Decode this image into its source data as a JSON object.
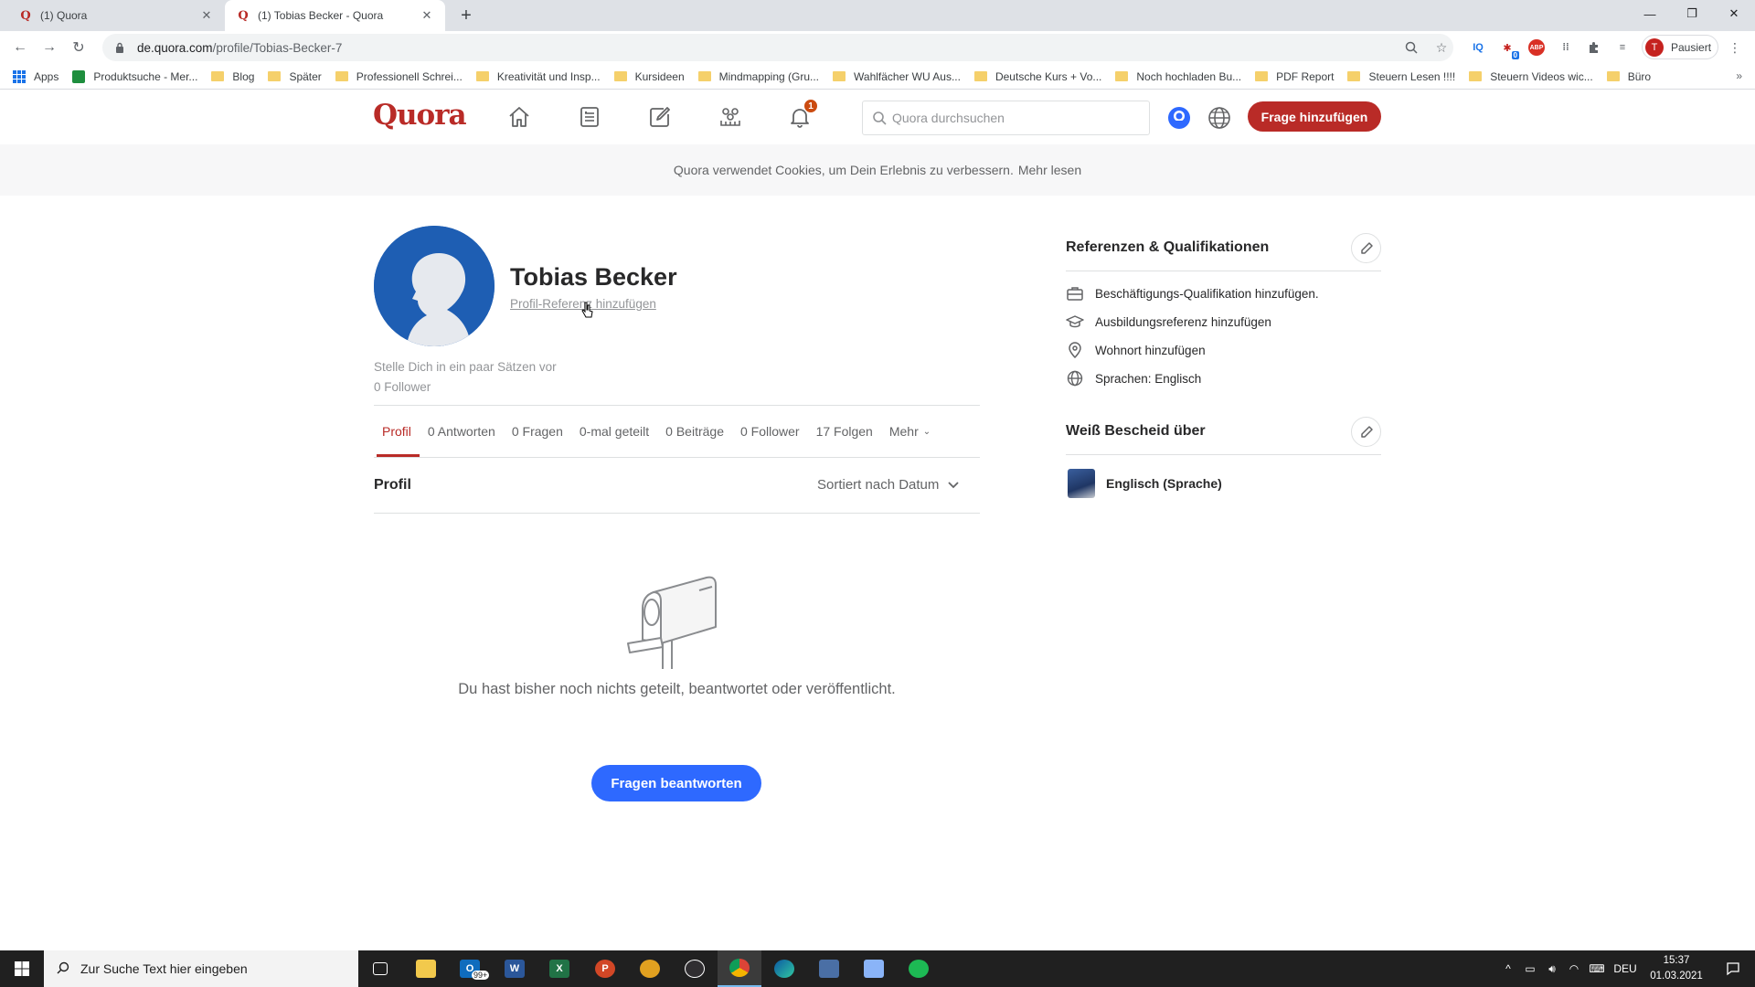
{
  "browser": {
    "tabs": [
      {
        "title": "(1) Quora"
      },
      {
        "title": "(1) Tobias Becker - Quora"
      }
    ],
    "url_host": "de.quora.com",
    "url_path": "/profile/Tobias-Becker-7",
    "profile_label": "Pausiert",
    "profile_initial": "T",
    "ext_badge": "0",
    "bookmarks": [
      {
        "label": "Apps",
        "icon": "apps-grid-icon"
      },
      {
        "label": "Produktsuche - Mer...",
        "icon": "site-icon"
      },
      {
        "label": "Blog",
        "icon": "folder-icon"
      },
      {
        "label": "Später",
        "icon": "folder-icon"
      },
      {
        "label": "Professionell Schrei...",
        "icon": "folder-icon"
      },
      {
        "label": "Kreativität und Insp...",
        "icon": "folder-icon"
      },
      {
        "label": "Kursideen",
        "icon": "folder-icon"
      },
      {
        "label": "Mindmapping (Gru...",
        "icon": "folder-icon"
      },
      {
        "label": "Wahlfächer WU Aus...",
        "icon": "folder-icon"
      },
      {
        "label": "Deutsche Kurs + Vo...",
        "icon": "folder-icon"
      },
      {
        "label": "Noch hochladen Bu...",
        "icon": "folder-icon"
      },
      {
        "label": "PDF Report",
        "icon": "folder-icon"
      },
      {
        "label": "Steuern Lesen !!!!",
        "icon": "folder-icon"
      },
      {
        "label": "Steuern Videos wic...",
        "icon": "folder-icon"
      },
      {
        "label": "Büro",
        "icon": "folder-icon"
      }
    ],
    "bookmarks_more": "»"
  },
  "quora": {
    "logo": "Quora",
    "notification_count": "1",
    "search_placeholder": "Quora durchsuchen",
    "add_question_label": "Frage hinzufügen",
    "brand_color": "#b92b27"
  },
  "cookie": {
    "text": "Quora verwendet Cookies, um Dein Erlebnis zu verbessern.",
    "link": "Mehr lesen"
  },
  "profile": {
    "name": "Tobias Becker",
    "credential_link": "Profil-Referenz hinzufügen",
    "intro_prompt": "Stelle Dich in ein paar Sätzen vor",
    "followers": "0 Follower",
    "tabs": [
      {
        "label": "Profil"
      },
      {
        "label": "0 Antworten"
      },
      {
        "label": "0 Fragen"
      },
      {
        "label": "0-mal geteilt"
      },
      {
        "label": "0 Beiträge"
      },
      {
        "label": "0 Follower"
      },
      {
        "label": "17 Folgen"
      },
      {
        "label": "Mehr"
      }
    ],
    "section_title": "Profil",
    "sort_label": "Sortiert nach Datum",
    "empty_message": "Du hast bisher noch nichts geteilt, beantwortet oder veröffentlicht.",
    "answer_button": "Fragen beantworten"
  },
  "sidebar": {
    "credentials_title": "Referenzen & Qualifikationen",
    "credentials": [
      {
        "label": "Beschäftigungs-Qualifikation hinzufügen.",
        "icon": "briefcase-icon"
      },
      {
        "label": "Ausbildungsreferenz hinzufügen",
        "icon": "graduation-cap-icon"
      },
      {
        "label": "Wohnort hinzufügen",
        "icon": "location-pin-icon"
      },
      {
        "label": "Sprachen: Englisch",
        "icon": "globe-icon"
      }
    ],
    "knows_title": "Weiß Bescheid über",
    "topics": [
      {
        "label": "Englisch (Sprache)"
      }
    ]
  },
  "taskbar": {
    "search_placeholder": "Zur Suche Text hier eingeben",
    "outlook_badge": "99+",
    "language": "DEU",
    "time": "15:37",
    "date": "01.03.2021"
  }
}
